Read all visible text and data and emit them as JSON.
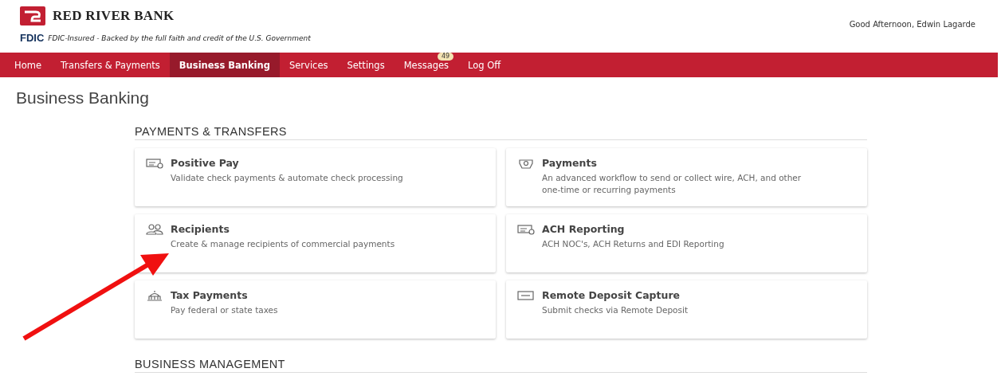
{
  "header": {
    "brand": "RED RIVER BANK",
    "fdic_mark": "FDIC",
    "fdic_notice": "FDIC-Insured - Backed by the full faith and credit of the U.S. Government",
    "greeting": "Good Afternoon, Edwin Lagarde"
  },
  "nav": [
    {
      "label": "Home",
      "selected": false
    },
    {
      "label": "Transfers & Payments",
      "selected": false
    },
    {
      "label": "Business Banking",
      "selected": true
    },
    {
      "label": "Services",
      "selected": false
    },
    {
      "label": "Settings",
      "selected": false
    },
    {
      "label": "Messages",
      "selected": false,
      "badge": "49"
    },
    {
      "label": "Log Off",
      "selected": false
    }
  ],
  "page_title": "Business Banking",
  "sections": [
    {
      "heading": "PAYMENTS & TRANSFERS",
      "cards": [
        {
          "title": "Positive Pay",
          "description": "Validate check payments & automate check processing"
        },
        {
          "title": "Payments",
          "description": "An advanced workflow to send or collect wire, ACH, and other one-time or recurring payments"
        },
        {
          "title": "Recipients",
          "description": "Create & manage recipients of commercial payments"
        },
        {
          "title": "ACH Reporting",
          "description": "ACH NOC's, ACH Returns and EDI Reporting"
        },
        {
          "title": "Tax Payments",
          "description": "Pay federal or state taxes"
        },
        {
          "title": "Remote Deposit Capture",
          "description": "Submit checks via Remote Deposit"
        }
      ]
    },
    {
      "heading": "BUSINESS MANAGEMENT"
    }
  ]
}
